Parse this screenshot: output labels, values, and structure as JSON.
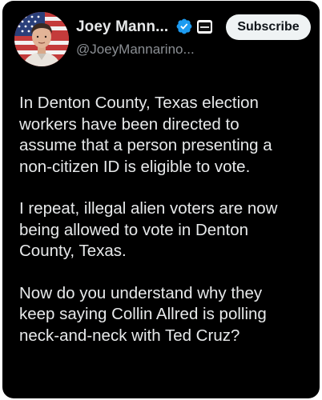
{
  "author": {
    "display_name": "Joey Mann...",
    "handle": "@JoeyMannarino...",
    "avatar_icon": "avatar-photo",
    "verified_icon": "verified-badge-icon",
    "affiliate_icon": "affiliate-badge-icon"
  },
  "actions": {
    "subscribe_label": "Subscribe"
  },
  "tweet": {
    "paragraphs": [
      "In Denton County, Texas election\nworkers have been directed to\nassume that a person presenting a\nnon-citizen ID is eligible to vote.",
      "I repeat, illegal alien voters are now\nbeing allowed to vote in Denton\nCounty, Texas.",
      "Now do you understand why they\nkeep saying Collin Allred is polling\nneck-and-neck with Ted Cruz?"
    ]
  },
  "colors": {
    "background": "#000000",
    "text": "#e7e9ea",
    "secondary_text": "#8b8f94",
    "verified_blue": "#1d9bf0",
    "button_bg": "#eff3f4"
  }
}
